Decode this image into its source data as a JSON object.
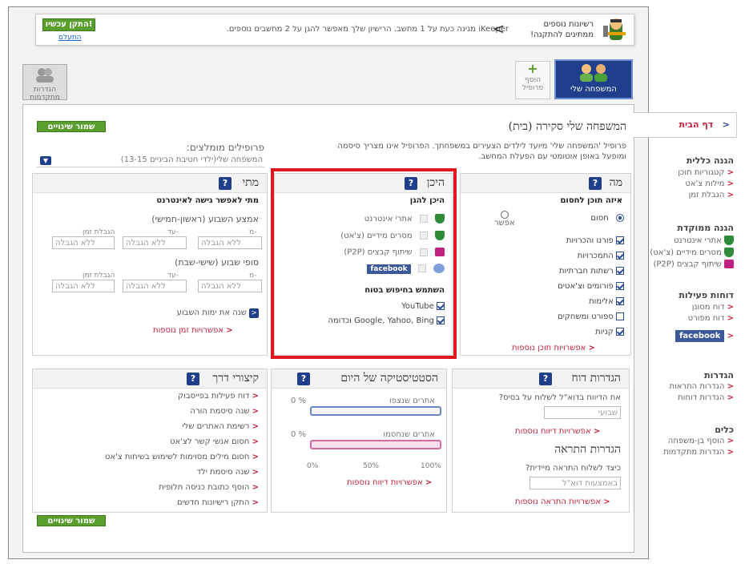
{
  "banner": {
    "install_button": "התקן עכשיו!",
    "ignore_link": "התעלם",
    "message": "iKeeper מגינה כעת על 1 מחשב. הרישיון שלך מאפשר להגן על 2 מחשבים נוספים.",
    "title_line1": "רשיונות נוספים",
    "title_line2": "ממתינים להתקנה!"
  },
  "tabs": {
    "my_family": "המשפחה שלי",
    "add_profile_line1": "הוסף",
    "add_profile_line2": "פרופיל",
    "advanced_settings": "הגדרות מתקדמות"
  },
  "main": {
    "save_button": "שמור שינויים",
    "title": "המשפחה שלי סקירה (בית)",
    "desc": "פרופיל 'המשפחה שלי' מיועד לילדים הצעירים במשפחתך. הפרופיל אינו מצריך סיסמה ומופעל באופן אוטומטי עם הפעלת המחשב.",
    "recommended_label": "פרופילים מומלצים:",
    "recommended_value": "המשפחה שלי(ילדי חטיבת הביניים 13-15)"
  },
  "what": {
    "title": "מה",
    "subtitle": "איזה תוכן לחסום",
    "block_label": "חסום",
    "allow_label": "אפשר",
    "items": [
      "פורנו והכרויות",
      "התמכרויות",
      "רשתות חברתיות",
      "פורומים וצ'אטים",
      "אלימות",
      "ספורט ומשחקים",
      "קניות"
    ],
    "more_link": "אפשרויות תוכן נוספות"
  },
  "where": {
    "title": "היכן",
    "subtitle": "היכן להגן",
    "items": [
      "אתרי אינטרנט",
      "מסרים מידיים (צ'אט)",
      "שיתוף קבצים (P2P)"
    ],
    "facebook": "facebook",
    "safe_search_title": "השתמש בחיפוש בטוח",
    "safe_search_items": [
      "YouTube",
      "Google, Yahoo, Bing וכדומה"
    ]
  },
  "when": {
    "title": "מתי",
    "subtitle": "מתי לאפשר גישה לאינטרנט",
    "weekday_label": "אמצע השבוע (ראשון-חמישי)",
    "weekend_label": "סופי שבוע (שישי-שבת)",
    "from_label": "מ-",
    "to_label": "עד-",
    "time_limit_label": "הגבלת זמן",
    "no_limit": "ללא הגבלה",
    "change_days": "שנה את ימות השבוע",
    "more_link": "אפשרויות זמן נוספות"
  },
  "report": {
    "title": "הגדרות דוח",
    "question": "את הדיווח בדוא\"ל לשלוח על בסיס?",
    "value": "שבועי",
    "more_link": "אפשרויות דיווח נוספות",
    "alert_title": "הגדרות התראה",
    "alert_question": "כיצד לשלוח התראה מיידית?",
    "alert_value": "באמצעות דוא\"ל",
    "alert_more": "אפשרויות התראה נוספות"
  },
  "stats": {
    "title": "הסטטיסטיקה של היום",
    "viewed_label": "אתרים שנצפו",
    "viewed_value": "0 %",
    "viewed_fraction": 0,
    "blocked_label": "אתרים שנחסמו",
    "blocked_value": "0 %",
    "blocked_fraction": 0,
    "scale": [
      "0%",
      "50%",
      "100%"
    ],
    "more_link": "אפשרויות דיווח נוספות"
  },
  "shortcuts": {
    "title": "קיצורי דרך",
    "items": [
      "דוח פעילות בפייסבוק",
      "שנה סיסמת הורה",
      "רשימת האתרים שלי",
      "חסום אנשי קשר לצ'אט",
      "חסום מילים מסוימות לשימוש בשיחות צ'אט",
      "שנה סיסמת ילד",
      "הוסף כתובת כניסה חלופית",
      "התקן רישיונות חדשים"
    ]
  },
  "sidebar": {
    "home": "דף הבית",
    "general_title": "הגנה כללית",
    "general_items": [
      "קטגוריות תוכן",
      "מילות צ'אט",
      "הגבלת זמן"
    ],
    "focused_title": "הגנה ממוקדת",
    "focused_items": [
      "אתרי אינטרנט",
      "מסרים מידיים (צ'אט)",
      "שיתוף קבצים (P2P)"
    ],
    "reports_title": "דוחות פעילות",
    "reports_items": [
      "דוח מסונן",
      "דוח מפורט"
    ],
    "facebook": "facebook",
    "settings_title": "הגדרות",
    "settings_items": [
      "הגדרות התראות",
      "הגדרות דוחות"
    ],
    "tools_title": "כלים",
    "tools_items": [
      "הוסף בן-משפחה",
      "הגדרות מתקדמות"
    ]
  },
  "colors": {
    "accent": "#1f3f8c",
    "highlight": "#e0171f",
    "brand_green": "#5a9e2e",
    "link_red": "#c0203a"
  }
}
